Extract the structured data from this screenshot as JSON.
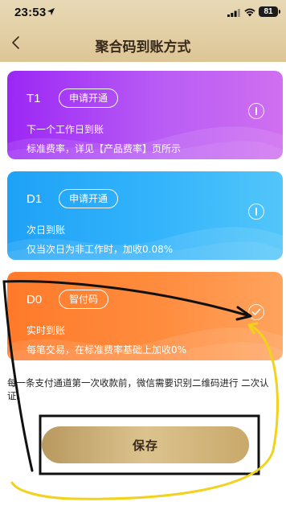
{
  "status": {
    "time": "23:53",
    "battery": "81"
  },
  "nav": {
    "title": "聚合码到账方式"
  },
  "cards": [
    {
      "code": "T1",
      "pill": "申请开通",
      "line1": "下一个工作日到账",
      "line2": "标准费率，详见【产品费率】页所示",
      "icon": "info-icon"
    },
    {
      "code": "D1",
      "pill": "申请开通",
      "line1": "次日到账",
      "line2": "仅当次日为非工作时，加收0.08%",
      "icon": "info-icon"
    },
    {
      "code": "D0",
      "pill": "智付码",
      "line1": "实时到账",
      "line2": "每笔交易，在标准费率基础上加收0%",
      "icon": "check-icon"
    }
  ],
  "notice": "每一条支付通道第一次收款前，微信需要识别二维码进行 二次认证。",
  "save_label": "保存",
  "colors": {
    "header_gold": "#e2cea3",
    "t1_purple": "#b85cf5",
    "d1_blue": "#34b4fb",
    "d0_orange": "#ff8c3e",
    "button_gold": "#dcc38e",
    "annotation_black": "#111111",
    "annotation_yellow": "#f2d21a"
  }
}
